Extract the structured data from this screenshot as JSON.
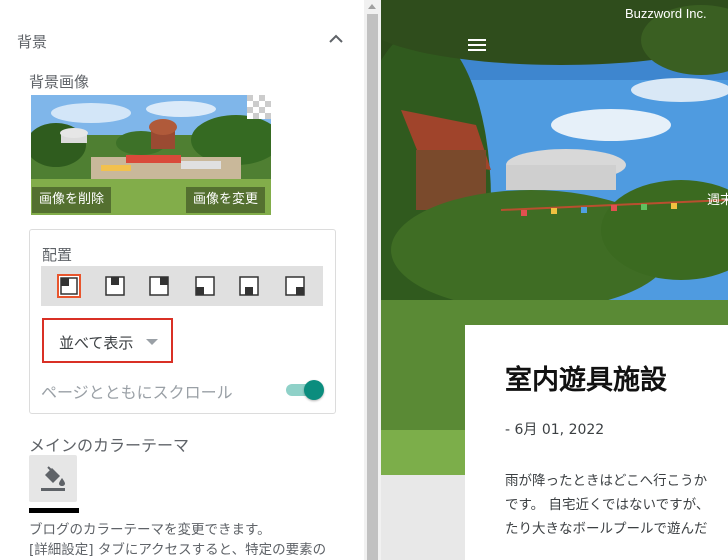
{
  "panel": {
    "section_title": "背景",
    "bg_image_label": "背景画像",
    "remove_image_label": "画像を削除",
    "change_image_label": "画像を変更",
    "placement_label": "配置",
    "selected_position_index": 0,
    "repeat_value": "並べて表示",
    "scroll_label": "ページとともにスクロール",
    "scroll_toggle_on": true,
    "theme_label": "メインのカラーテーマ",
    "theme_color": "#000000",
    "help_line1": "ブログのカラーテーマを変更できます。",
    "help_line2": "[詳細設定] タブにアクセスすると、特定の要素の"
  },
  "preview": {
    "site_name": "Buzzword Inc.",
    "side_text": "週末",
    "post_title": "室内遊具施設",
    "post_date": "- 6月 01, 2022",
    "body_lines": [
      "雨が降ったときはどこへ行こうか",
      "です。 自宅近くではないですが、",
      "たり大きなボールプールで遊んだ"
    ]
  },
  "colors": {
    "accent": "#0b8d7e",
    "highlight": "#d93025",
    "selected_position": "#e8552d"
  }
}
